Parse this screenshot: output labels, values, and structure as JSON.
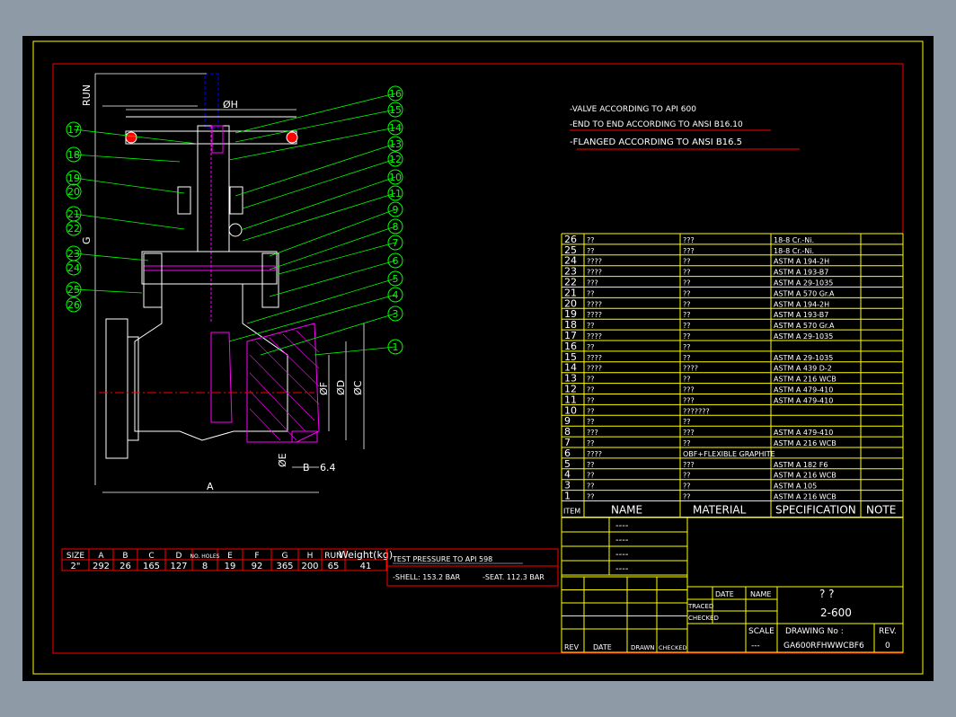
{
  "notes": {
    "line1": "-VALVE ACCORDING TO API 600",
    "line2": "-END TO END ACCORDING TO ANSI B16.10",
    "line3": "-FLANGED ACCORDING TO ANSI B16.5"
  },
  "dimensions": {
    "run": "RUN",
    "oh": "ØH",
    "g": "G",
    "a": "A",
    "of": "ØF",
    "od": "ØD",
    "oc": "ØC",
    "oe": "ØE",
    "b": "B",
    "t64": "6.4"
  },
  "balloons": [
    "16",
    "15",
    "14",
    "13",
    "12",
    "10",
    "11",
    "9",
    "8",
    "7",
    "6",
    "5",
    "4",
    "3",
    "1",
    "17",
    "18",
    "19",
    "20",
    "21",
    "22",
    "23",
    "24",
    "25",
    "26"
  ],
  "bom": [
    {
      "item": "26",
      "name": "??",
      "material": "???",
      "spec": "18-8 Cr.-Ni."
    },
    {
      "item": "25",
      "name": "??",
      "material": "???",
      "spec": "18-8 Cr.-Ni."
    },
    {
      "item": "24",
      "name": "????",
      "material": "??",
      "spec": "ASTM A 194-2H"
    },
    {
      "item": "23",
      "name": "????",
      "material": "??",
      "spec": "ASTM A 193-B7"
    },
    {
      "item": "22",
      "name": "???",
      "material": "??",
      "spec": "ASTM A 29-1035"
    },
    {
      "item": "21",
      "name": "??",
      "material": "??",
      "spec": "ASTM A 570 Gr.A"
    },
    {
      "item": "20",
      "name": "????",
      "material": "??",
      "spec": "ASTM A 194-2H"
    },
    {
      "item": "19",
      "name": "????",
      "material": "??",
      "spec": "ASTM A 193-B7"
    },
    {
      "item": "18",
      "name": "??",
      "material": "??",
      "spec": "ASTM A 570 Gr.A"
    },
    {
      "item": "17",
      "name": "????",
      "material": "??",
      "spec": "ASTM A 29-1035"
    },
    {
      "item": "16",
      "name": "??",
      "material": "??",
      "spec": ""
    },
    {
      "item": "15",
      "name": "????",
      "material": "??",
      "spec": "ASTM A 29-1035"
    },
    {
      "item": "14",
      "name": "????",
      "material": "????",
      "spec": "ASTM A 439 D-2"
    },
    {
      "item": "13",
      "name": "??",
      "material": "??",
      "spec": "ASTM A 216 WCB"
    },
    {
      "item": "12",
      "name": "??",
      "material": "???",
      "spec": "ASTM A 479-410"
    },
    {
      "item": "11",
      "name": "??",
      "material": "???",
      "spec": "ASTM A 479-410"
    },
    {
      "item": "10",
      "name": "??",
      "material": "???????",
      "spec": ""
    },
    {
      "item": "9",
      "name": "??",
      "material": "??",
      "spec": ""
    },
    {
      "item": "8",
      "name": "???",
      "material": "???",
      "spec": "ASTM A 479-410"
    },
    {
      "item": "7",
      "name": "??",
      "material": "??",
      "spec": "ASTM A 216 WCB"
    },
    {
      "item": "6",
      "name": "????",
      "material": "OBF+FLEXIBLE GRAPHITE",
      "spec": ""
    },
    {
      "item": "5",
      "name": "??",
      "material": "???",
      "spec": "ASTM A 182 F6"
    },
    {
      "item": "4",
      "name": "??",
      "material": "??",
      "spec": "ASTM A 216 WCB"
    },
    {
      "item": "3",
      "name": "??",
      "material": "??",
      "spec": "ASTM A 105"
    },
    {
      "item": "1",
      "name": "??",
      "material": "??",
      "spec": "ASTM A 216 WCB"
    }
  ],
  "bom_header": {
    "item": "ITEM",
    "name": "NAME",
    "material": "MATERIAL",
    "spec": "SPECIFICATION",
    "note": "NOTE"
  },
  "dim_table": {
    "headers": [
      "SIZE",
      "A",
      "B",
      "C",
      "D",
      "NO. HOLES",
      "E",
      "F",
      "G",
      "H",
      "RUN",
      "Weight(kg)"
    ],
    "values": [
      "2\"",
      "292",
      "26",
      "165",
      "127",
      "8",
      "19",
      "92",
      "365",
      "200",
      "65",
      "41"
    ]
  },
  "test": {
    "title": "TEST PRESSURE TO API 598",
    "shell": "-SHELL: 153.2 BAR",
    "seat": "-SEAT. 112.3 BAR"
  },
  "revisions": {
    "dashes": [
      "----",
      "----",
      "----",
      "----"
    ],
    "rev": "REV",
    "date": "DATE",
    "drawn": "DRAWN",
    "checked": "CHECKED"
  },
  "titleblock": {
    "date": "DATE",
    "name": "NAME",
    "traced": "TRACED",
    "checked": "CHECKED",
    "title_q": "?    ?",
    "class": "2-600",
    "scale_label": "SCALE",
    "scale_value": "---",
    "drawing_no_label": "DRAWING No :",
    "drawing_no": "GA600RFHWWCBF6",
    "rev_label": "REV.",
    "rev_value": "0"
  },
  "colors": {
    "frame": "#ff0000",
    "grid": "#ffff00",
    "leader": "#00ff00",
    "text": "#ffffff",
    "hatch": "#ff00ff",
    "stem": "#0000ff"
  }
}
